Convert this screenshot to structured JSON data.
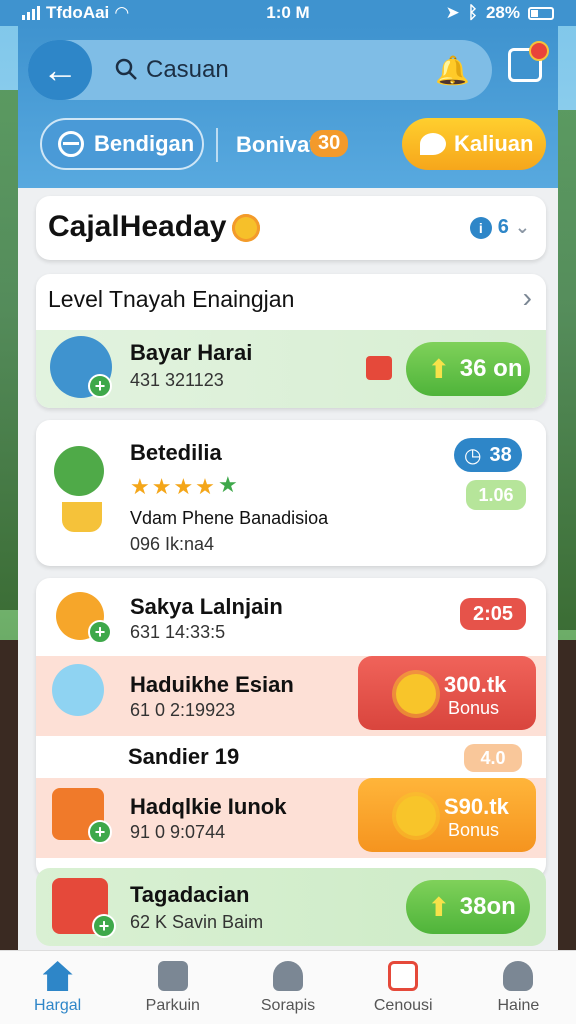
{
  "status_bar": {
    "carrier": "TfdoAai",
    "time": "1:0 M",
    "battery": "28%"
  },
  "search": {
    "value": "Casuan"
  },
  "filters": {
    "chip1": "Bendigan",
    "bonus_label": "Bonivat",
    "bonus_count": "30",
    "chip2": "Kaliuan"
  },
  "section": {
    "title": "CajalHeaday",
    "count": "6"
  },
  "list_header": "Level Tnayah Enaingjan",
  "items": [
    {
      "title": "Bayar Harai",
      "sub": "431 321123",
      "action": "36 on"
    },
    {
      "title": "Betedilia",
      "badge": "38",
      "badge2": "1.06",
      "desc": "Vdam Phene Banadisioa",
      "sub": "096 Ik:na4",
      "rating": "★★★★"
    },
    {
      "title": "Sakya Lalnjain",
      "sub": "631 14:33:5",
      "badge": "2:05"
    },
    {
      "title": "Haduikhe Esian",
      "sub": "61 0 2:19923",
      "bonus_amount": "300.tk",
      "bonus_label": "Bonus"
    },
    {
      "title": "Sandier 19",
      "badge": "4.0"
    },
    {
      "title": "Hadqlkie Iunok",
      "sub": "91 0 9:0744",
      "bonus_amount": "S90.tk",
      "bonus_label": "Bonus"
    },
    {
      "title": "Tagadacian",
      "sub": "62 K Savin Baim",
      "action": "38on"
    }
  ],
  "tabs": [
    {
      "label": "Hargal",
      "icon": "home-icon",
      "active": true
    },
    {
      "label": "Parkuin",
      "icon": "package-icon"
    },
    {
      "label": "Sorapis",
      "icon": "hat-icon"
    },
    {
      "label": "Cenousi",
      "icon": "camera-icon"
    },
    {
      "label": "Haine",
      "icon": "person-icon"
    }
  ]
}
